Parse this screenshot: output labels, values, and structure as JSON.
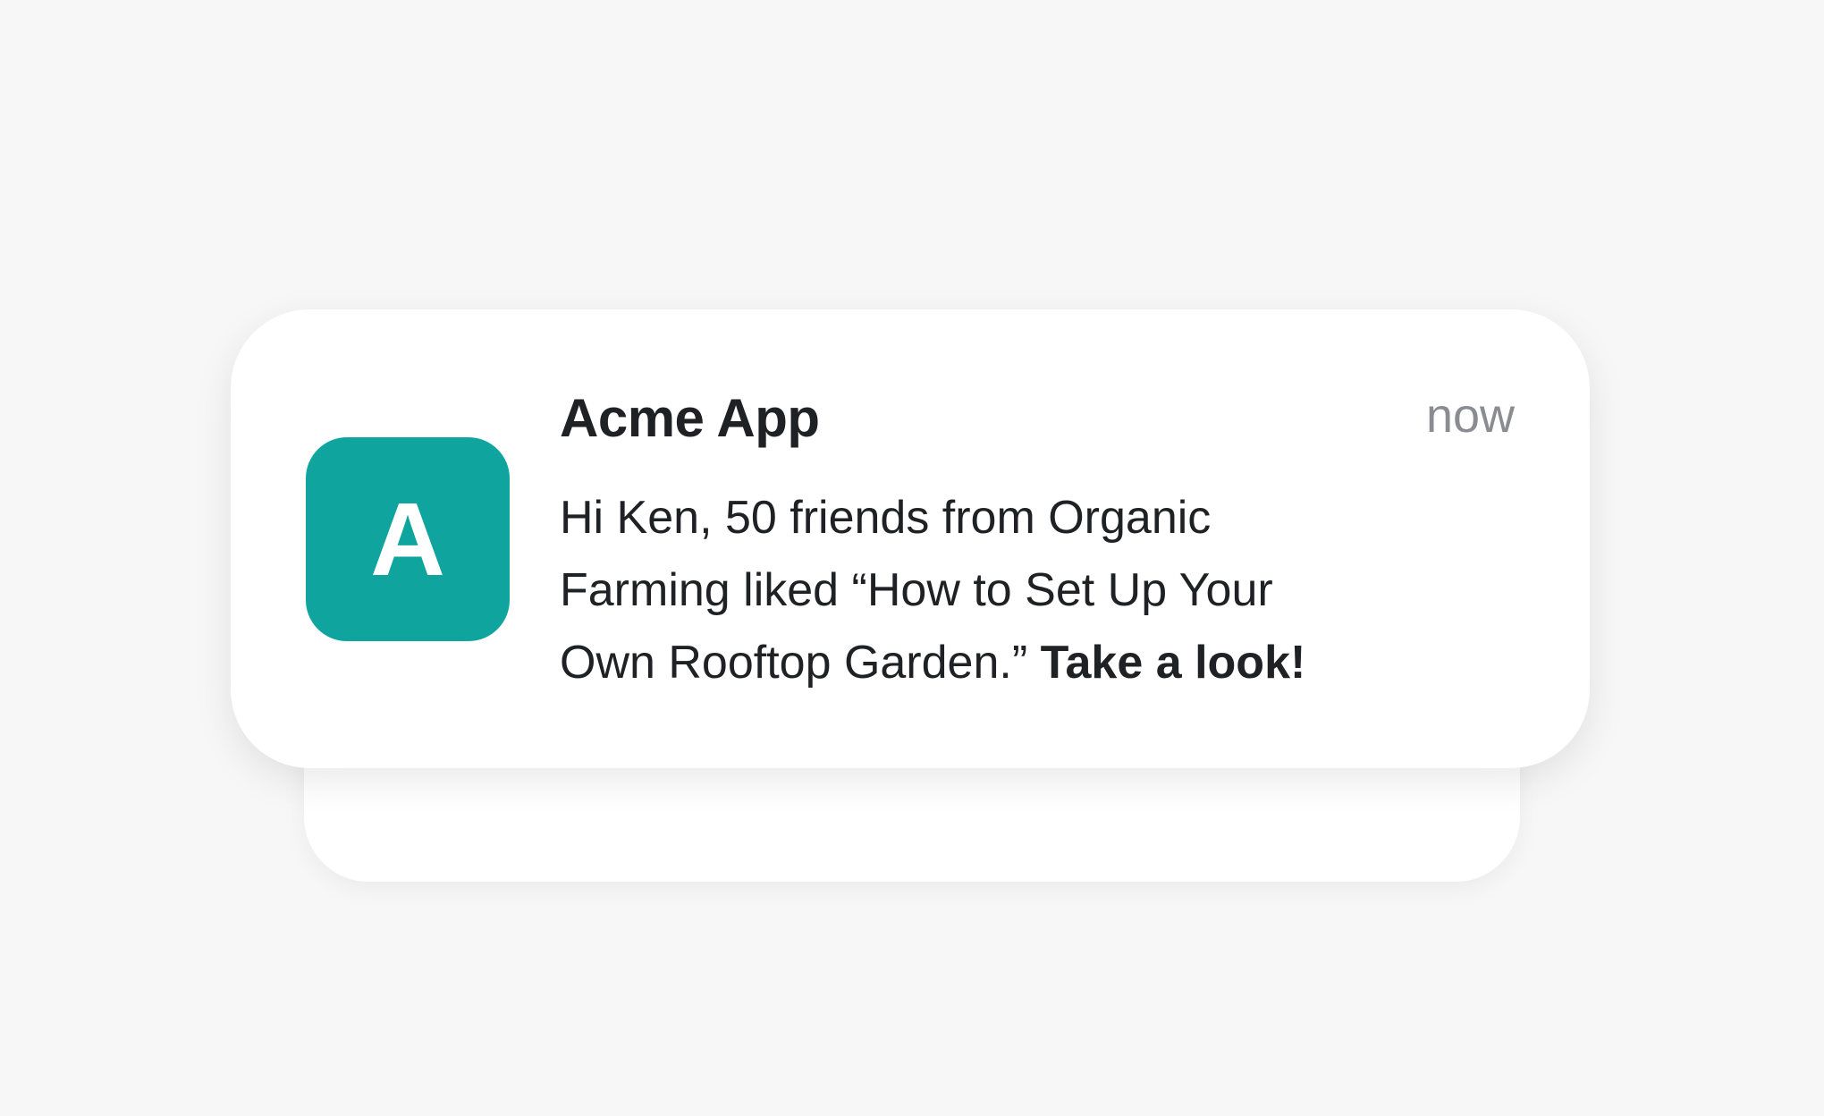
{
  "notification": {
    "app_icon_letter": "A",
    "app_name": "Acme App",
    "timestamp": "now",
    "line1": "Hi Ken, 50 friends from Organic",
    "line2": "Farming liked “How to Set Up Your",
    "line3": "Own Rooftop Garden.” ",
    "cta": "Take a look!",
    "icon_color": "#0fa59e"
  }
}
